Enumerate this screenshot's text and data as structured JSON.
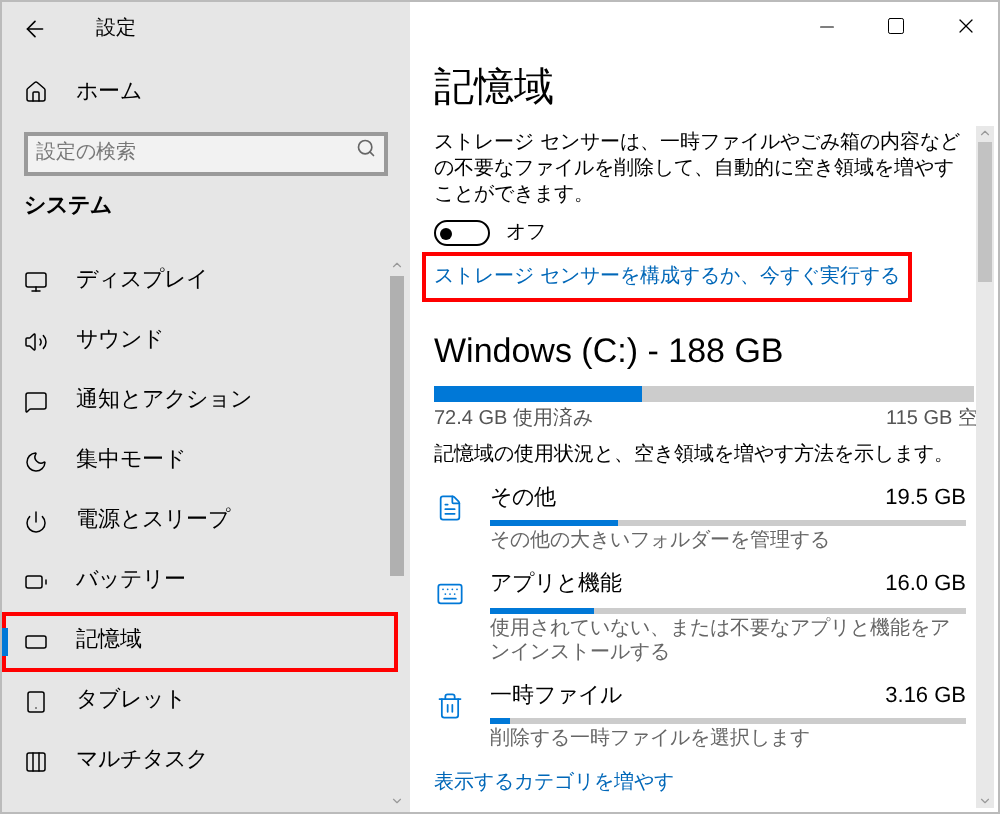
{
  "window": {
    "title": "設定"
  },
  "sidebar": {
    "home": "ホーム",
    "search": {
      "placeholder": "設定の検索"
    },
    "section": "システム",
    "items": [
      {
        "label": "ディスプレイ",
        "selected": false,
        "highlighted": false
      },
      {
        "label": "サウンド",
        "selected": false,
        "highlighted": false
      },
      {
        "label": "通知とアクション",
        "selected": false,
        "highlighted": false
      },
      {
        "label": "集中モード",
        "selected": false,
        "highlighted": false
      },
      {
        "label": "電源とスリープ",
        "selected": false,
        "highlighted": false
      },
      {
        "label": "バッテリー",
        "selected": false,
        "highlighted": false
      },
      {
        "label": "記憶域",
        "selected": true,
        "highlighted": true
      },
      {
        "label": "タブレット",
        "selected": false,
        "highlighted": false
      },
      {
        "label": "マルチタスク",
        "selected": false,
        "highlighted": false
      }
    ]
  },
  "page": {
    "title": "記憶域",
    "description": "ストレージ センサーは、一時ファイルやごみ箱の内容などの不要なファイルを削除して、自動的に空き領域を増やすことができます。",
    "toggle": {
      "on": false,
      "label": "オフ"
    },
    "link": {
      "text": "ストレージ センサーを構成するか、今すぐ実行する",
      "highlighted": true
    },
    "drive": {
      "title": "Windows (C:) - 188 GB",
      "level": 0.385,
      "used": "72.4 GB 使用済み",
      "free": "115 GB 空"
    },
    "usage_note": "記憶域の使用状況と、空き領域を増やす方法を示します。",
    "categories": [
      {
        "name": "その他",
        "size": "19.5 GB",
        "level": 0.27,
        "caption": "その他の大きいフォルダーを管理する"
      },
      {
        "name": "アプリと機能",
        "size": "16.0 GB",
        "level": 0.22,
        "caption": "使用されていない、または不要なアプリと機能をアンインストールする"
      },
      {
        "name": "一時ファイル",
        "size": "3.16 GB",
        "level": 0.04,
        "caption": "削除する一時ファイルを選択します"
      }
    ],
    "more_link": "表示するカテゴリを増やす"
  }
}
